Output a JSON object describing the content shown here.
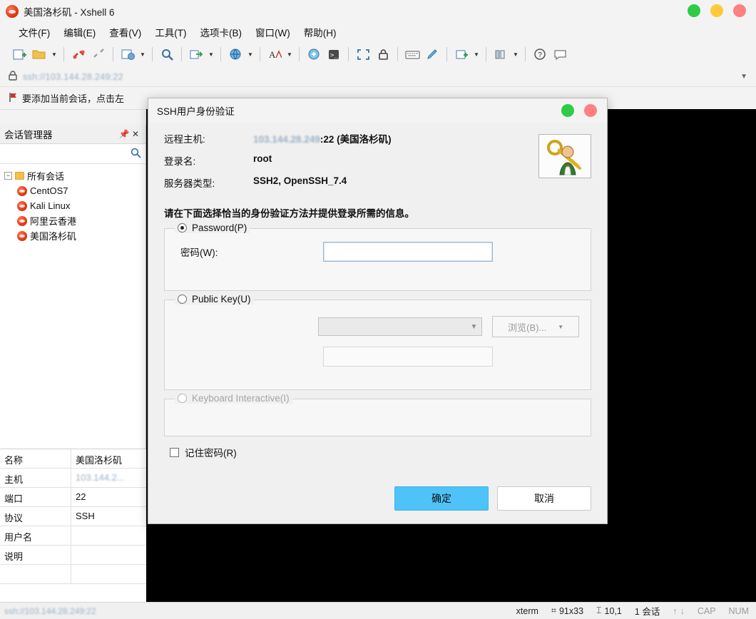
{
  "window": {
    "title": "美国洛杉矶 - Xshell 6",
    "logo_icon": "xshell-logo-icon",
    "buttons": {
      "minimize": "●",
      "maximize": "●",
      "close": "●"
    }
  },
  "menubar": [
    {
      "label": "文件(F)"
    },
    {
      "label": "编辑(E)"
    },
    {
      "label": "查看(V)"
    },
    {
      "label": "工具(T)"
    },
    {
      "label": "选项卡(B)"
    },
    {
      "label": "窗口(W)"
    },
    {
      "label": "帮助(H)"
    }
  ],
  "toolbar": {
    "items": [
      {
        "name": "new-session-icon"
      },
      {
        "name": "open-folder-icon"
      },
      {
        "name": "connect-icon"
      },
      {
        "name": "disconnect-icon"
      },
      {
        "name": "session-properties-icon"
      },
      {
        "name": "find-icon"
      },
      {
        "name": "file-transfer-icon"
      },
      {
        "name": "globe-icon"
      },
      {
        "name": "font-icon"
      },
      {
        "name": "compose-icon"
      },
      {
        "name": "ssh-copy-icon"
      },
      {
        "name": "fullscreen-icon"
      },
      {
        "name": "lock-icon"
      },
      {
        "name": "keyboard-icon"
      },
      {
        "name": "highlight-icon"
      },
      {
        "name": "add-window-icon"
      },
      {
        "name": "arrange-icon"
      },
      {
        "name": "help-icon"
      },
      {
        "name": "comment-icon"
      }
    ]
  },
  "address_bar": {
    "lock_icon": "lock-icon",
    "value": "ssh://103.144.28.249:22"
  },
  "notice": {
    "flag_icon": "flag-icon",
    "text": "要添加当前会话，点击左"
  },
  "session_manager": {
    "title": "会话管理器",
    "pin_icon": "pin-icon",
    "close_icon": "close-icon",
    "search_placeholder": "",
    "search_icon": "search-icon",
    "root": "所有会话",
    "sessions": [
      {
        "label": "CentOS7"
      },
      {
        "label": "Kali Linux"
      },
      {
        "label": "阿里云香港"
      },
      {
        "label": "美国洛杉矶"
      }
    ]
  },
  "properties": {
    "rows": [
      {
        "key": "名称",
        "value": "美国洛杉矶",
        "blur": false
      },
      {
        "key": "主机",
        "value": "103.144.2...",
        "blur": true
      },
      {
        "key": "端口",
        "value": "22",
        "blur": false
      },
      {
        "key": "协议",
        "value": "SSH",
        "blur": false
      },
      {
        "key": "用户名",
        "value": "",
        "blur": false
      },
      {
        "key": "说明",
        "value": "",
        "blur": false
      },
      {
        "key": "",
        "value": "",
        "blur": false
      }
    ]
  },
  "dialog": {
    "title": "SSH用户身份验证",
    "window_buttons": {
      "minimize": "●",
      "close": "●"
    },
    "key_icon": "ssh-key-person-icon",
    "info": [
      {
        "label": "远程主机:",
        "blur_value": "103.144.28.249",
        "value": ":22 (美国洛杉矶)"
      },
      {
        "label": "登录名:",
        "blur_value": "",
        "value": "root"
      },
      {
        "label": "服务器类型:",
        "blur_value": "",
        "value": "SSH2, OpenSSH_7.4"
      }
    ],
    "prompt": "请在下面选择恰当的身份验证方法并提供登录所需的信息。",
    "password_group": {
      "label": "Password(P)",
      "selected": true,
      "field_label": "密码(W):",
      "field_value": "",
      "field_placeholder": ""
    },
    "publickey_group": {
      "label": "Public Key(U)",
      "selected": false,
      "user_key_value": "",
      "browse_label": "浏览(B)...",
      "passphrase_value": ""
    },
    "keyboard_group": {
      "label": "Keyboard Interactive(I)",
      "selected": false,
      "disabled": true
    },
    "remember": {
      "label": "记住密码(R)",
      "checked": false
    },
    "ok_label": "确定",
    "cancel_label": "取消"
  },
  "statusbar": {
    "left": "ssh://103.144.28.249:22",
    "terminal_type": "xterm",
    "size_icon": "size-icon",
    "size": "91x33",
    "cursor_icon": "cursor-icon",
    "cursor": "10,1",
    "sessions": "1 会话",
    "up_icon": "arrow-up-icon",
    "down_icon": "arrow-down-icon",
    "cap": "CAP",
    "num": "NUM"
  }
}
